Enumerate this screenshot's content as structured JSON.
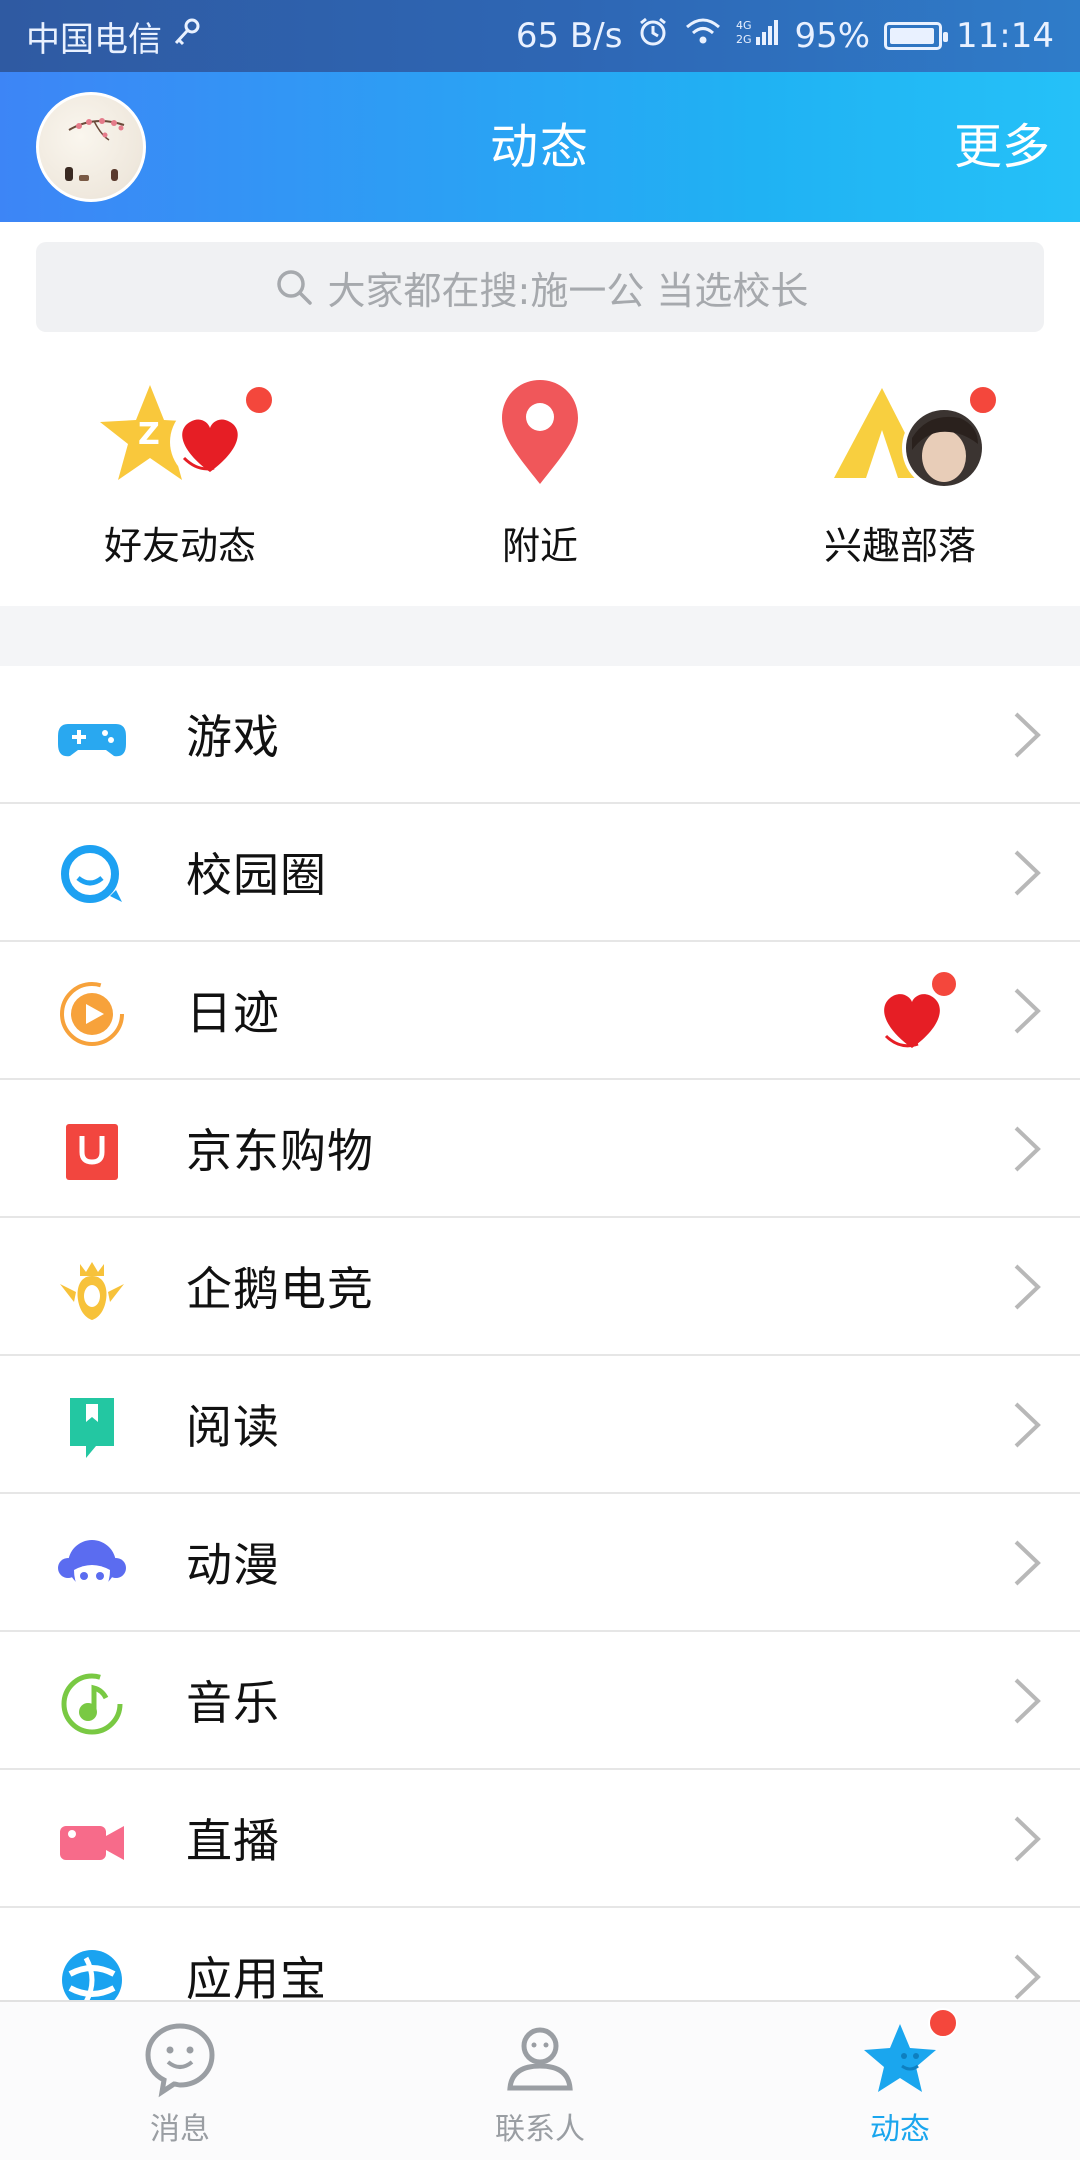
{
  "status_bar": {
    "carrier": "中国电信",
    "speed": "65 B/s",
    "network": "4G 2G",
    "battery": "95%",
    "battery_level": 0.95,
    "time": "11:14"
  },
  "header": {
    "title": "动态",
    "more": "更多"
  },
  "search": {
    "placeholder": "大家都在搜:施一公 当选校长"
  },
  "quick_entries": [
    {
      "label": "好友动态",
      "icon": "qzone-star-icon",
      "has_dot": true
    },
    {
      "label": "附近",
      "icon": "location-pin-icon",
      "has_dot": false
    },
    {
      "label": "兴趣部落",
      "icon": "tribe-tent-icon",
      "has_dot": true
    }
  ],
  "list": [
    {
      "label": "游戏",
      "icon": "gamepad-icon",
      "color": "#29a8f0"
    },
    {
      "label": "校园圈",
      "icon": "campus-circle-icon",
      "color": "#1da1f2"
    },
    {
      "label": "日迹",
      "icon": "play-circle-icon",
      "color": "#f7a23b",
      "has_badge": true
    },
    {
      "label": "京东购物",
      "icon": "jd-bag-icon",
      "color": "#f2463f"
    },
    {
      "label": "企鹅电竞",
      "icon": "esports-crown-icon",
      "color": "#f7c23a"
    },
    {
      "label": "阅读",
      "icon": "book-icon",
      "color": "#23c7a2"
    },
    {
      "label": "动漫",
      "icon": "anime-face-icon",
      "color": "#5b6cf0"
    },
    {
      "label": "音乐",
      "icon": "music-note-icon",
      "color": "#79c943"
    },
    {
      "label": "直播",
      "icon": "video-camera-icon",
      "color": "#f76b8a"
    },
    {
      "label": "应用宝",
      "icon": "app-store-icon",
      "color": "#1aa3f0"
    }
  ],
  "tabs": [
    {
      "label": "消息",
      "icon": "chat-bubble-icon",
      "active": false
    },
    {
      "label": "联系人",
      "icon": "contact-person-icon",
      "active": false
    },
    {
      "label": "动态",
      "icon": "star-icon",
      "active": true,
      "has_dot": true
    }
  ],
  "colors": {
    "header_start": "#3d85f6",
    "header_end": "#25c1f8",
    "red_dot": "#f4473c",
    "active_tab": "#1aa6ee"
  }
}
